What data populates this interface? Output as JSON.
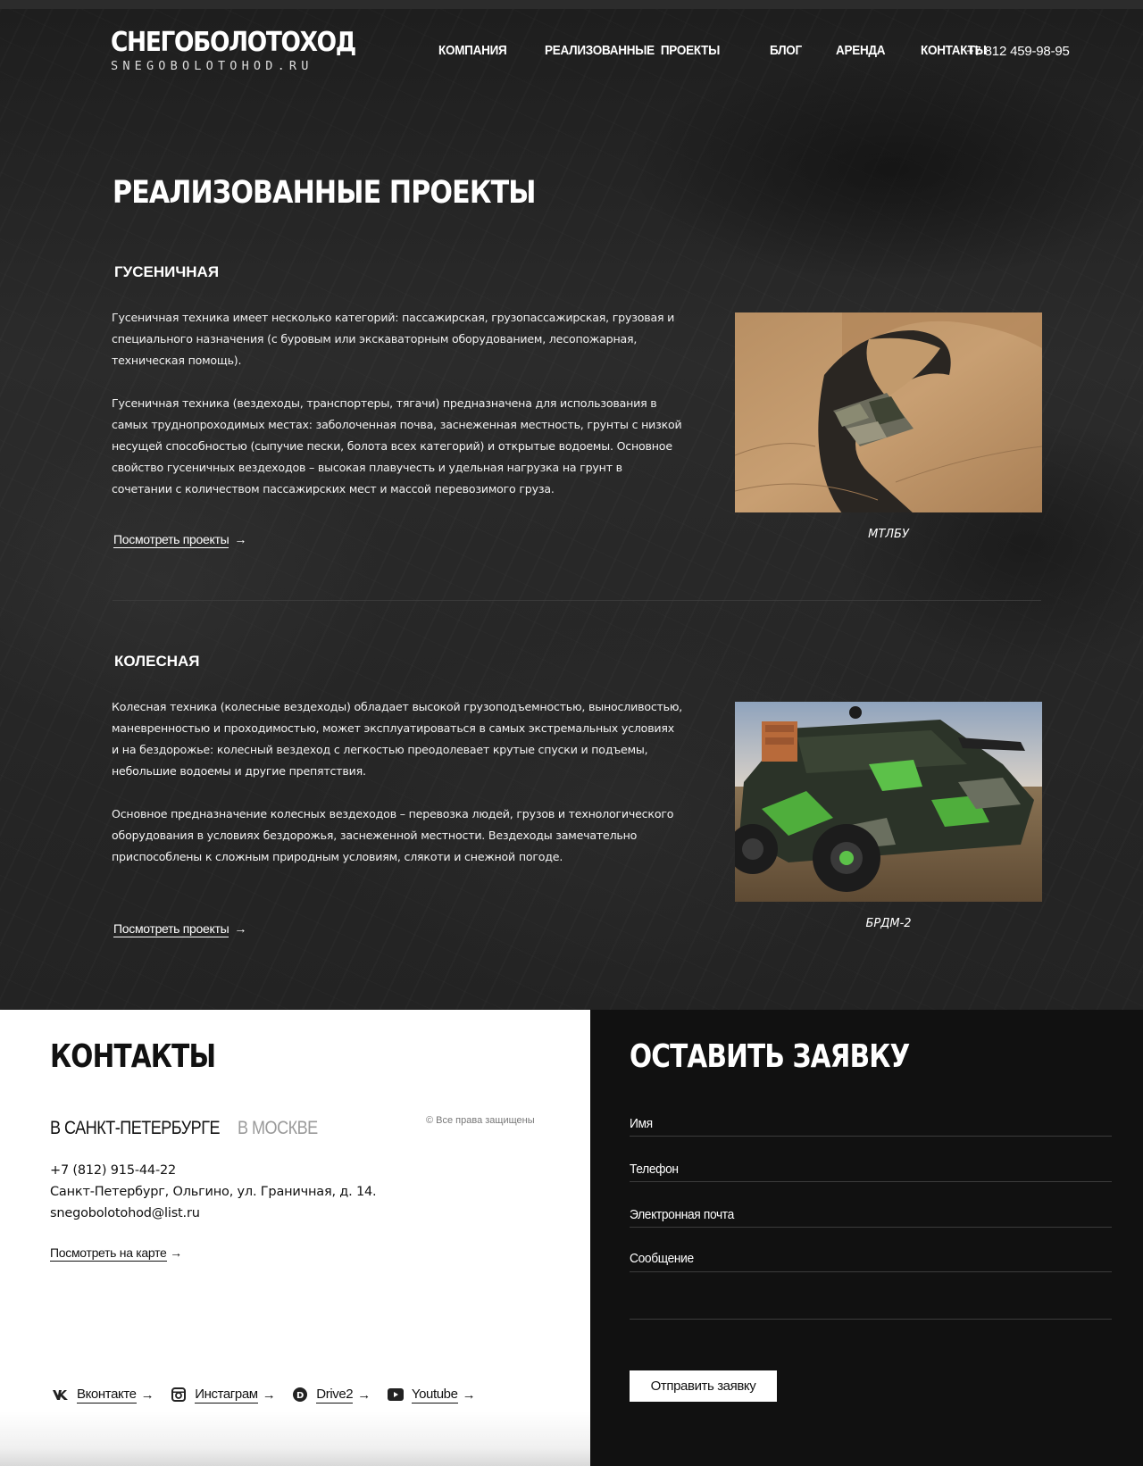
{
  "header": {
    "logo_main": "СНЕГОБОЛОТОХОД",
    "logo_sub": "SNEGOBOLOTOHOD.RU",
    "nav": [
      "КОМПАНИЯ",
      "РЕАЛИЗОВАННЫЕ  ПРОЕКТЫ",
      "БЛОГ",
      "АРЕНДА",
      "КОНТАКТЫ"
    ],
    "phone": "+7 812 459-98-95"
  },
  "page_title": "РЕАЛИЗОВАННЫЕ ПРОЕКТЫ",
  "sections": [
    {
      "title": "ГУСЕНИЧНАЯ",
      "paragraphs": [
        "Гусеничная техника имеет несколько категорий: пассажирская, грузопассажирская, грузовая и специального назначения (с буровым или экскаваторным оборудованием, лесопожарная, техническая помощь).",
        "Гусеничная техника (вездеходы, транспортеры, тягачи) предназначена для использования в самых труднопроходимых местах: заболоченная почва, заснеженная местность, грунты с низкой несущей способностью (сыпучие пески, болота всех категорий) и открытые водоемы. Основное свойство гусеничных вездеходов – высокая плавучесть и удельная нагрузка на грунт в сочетании с количеством пассажирских мест и массой перевозимого груза."
      ],
      "link": "Посмотреть проекты",
      "arrow": "→",
      "caption": "МТЛБУ"
    },
    {
      "title": "КОЛЕСНАЯ",
      "paragraphs": [
        "Колесная техника (колесные вездеходы) обладает высокой грузоподъемностью, выносливостью, маневренностью и проходимостью, может эксплуатироваться в самых экстремальных условиях и на бездорожье: колесный вездеход с легкостью преодолевает крутые спуски и подъемы, небольшие водоемы и другие препятствия.",
        "Основное предназначение колесных вездеходов – перевозка людей, грузов и технологического оборудования в условиях бездорожья, заснеженной местности. Вездеходы замечательно приспособлены к сложным природным условиям, слякоти и снежной погоде."
      ],
      "link": "Посмотреть проекты",
      "arrow": "→",
      "caption": "БРДМ-2"
    }
  ],
  "contacts": {
    "title": "КОНТАКТЫ",
    "city_active": "В САНКТ-ПЕТЕРБУРГЕ",
    "city_inactive": "В МОСКВЕ",
    "copyright": "© Все права защищены",
    "phone": "+7 (812) 915-44-22",
    "address": "Санкт-Петербург, Ольгино, ул. Граничная, д. 14.",
    "email": "snegobolotohod@list.ru",
    "map_link": "Посмотреть на карте",
    "arrow": "→",
    "socials": [
      {
        "label": "Вконтакте",
        "icon": "vk-icon"
      },
      {
        "label": "Инстаграм",
        "icon": "instagram-icon"
      },
      {
        "label": "Drive2",
        "icon": "drive2-icon"
      },
      {
        "label": "Youtube",
        "icon": "youtube-icon"
      }
    ]
  },
  "order_form": {
    "title": "ОСТАВИТЬ ЗАЯВКУ",
    "name_label": "Имя",
    "phone_label": "Телефон",
    "email_label": "Электронная почта",
    "message_label": "Сообщение",
    "submit_label": "Отправить заявку"
  }
}
